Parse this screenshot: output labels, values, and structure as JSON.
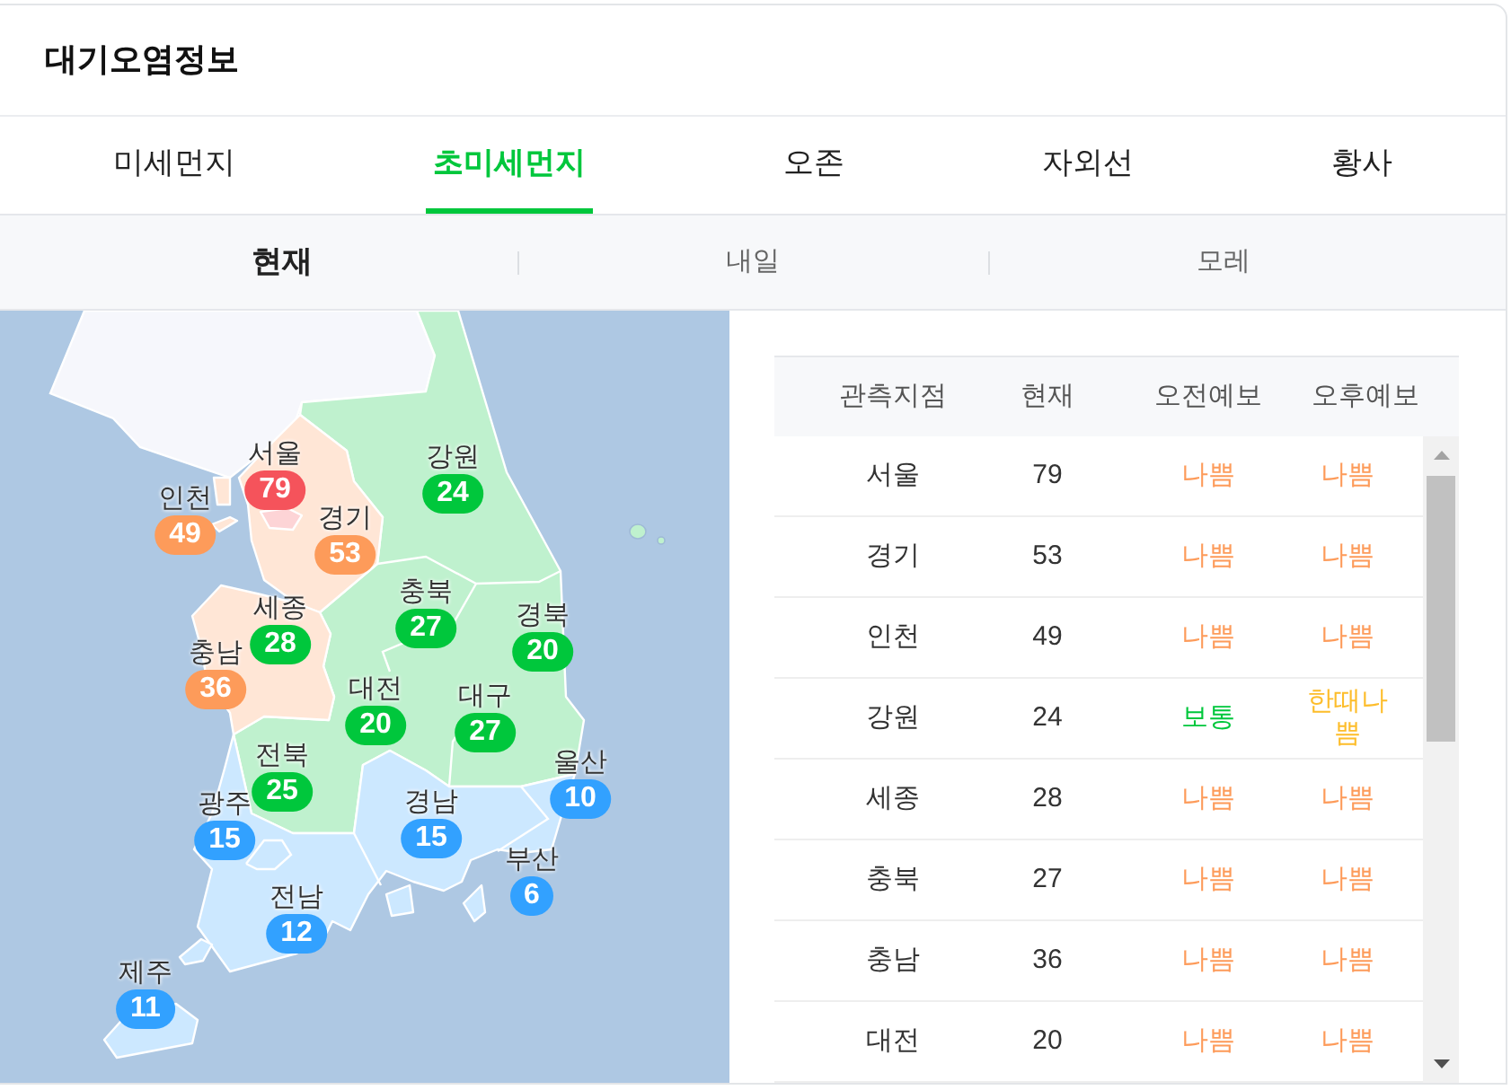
{
  "header": {
    "title": "대기오염정보"
  },
  "tabs": [
    {
      "label": "미세먼지",
      "selected": false
    },
    {
      "label": "초미세먼지",
      "selected": true
    },
    {
      "label": "오존",
      "selected": false
    },
    {
      "label": "자외선",
      "selected": false
    },
    {
      "label": "황사",
      "selected": false
    }
  ],
  "periods": [
    {
      "label": "현재",
      "selected": true
    },
    {
      "label": "내일",
      "selected": false
    },
    {
      "label": "모레",
      "selected": false
    }
  ],
  "map": {
    "markers": [
      {
        "name": "서울",
        "value": "79",
        "color": "#f5535b"
      },
      {
        "name": "강원",
        "value": "24",
        "color": "#00c73c"
      },
      {
        "name": "인천",
        "value": "49",
        "color": "#fd9b5a"
      },
      {
        "name": "경기",
        "value": "53",
        "color": "#fd9b5a"
      },
      {
        "name": "충북",
        "value": "27",
        "color": "#00c73c"
      },
      {
        "name": "세종",
        "value": "28",
        "color": "#00c73c"
      },
      {
        "name": "경북",
        "value": "20",
        "color": "#00c73c"
      },
      {
        "name": "충남",
        "value": "36",
        "color": "#fd9b5a"
      },
      {
        "name": "대전",
        "value": "20",
        "color": "#00c73c"
      },
      {
        "name": "대구",
        "value": "27",
        "color": "#00c73c"
      },
      {
        "name": "전북",
        "value": "25",
        "color": "#00c73c"
      },
      {
        "name": "울산",
        "value": "10",
        "color": "#32a1ff"
      },
      {
        "name": "광주",
        "value": "15",
        "color": "#32a1ff"
      },
      {
        "name": "경남",
        "value": "15",
        "color": "#32a1ff"
      },
      {
        "name": "부산",
        "value": "6",
        "color": "#32a1ff"
      },
      {
        "name": "전남",
        "value": "12",
        "color": "#32a1ff"
      },
      {
        "name": "제주",
        "value": "11",
        "color": "#32a1ff"
      }
    ]
  },
  "table": {
    "columns": [
      "관측지점",
      "현재",
      "오전예보",
      "오후예보"
    ],
    "rows": [
      {
        "station": "서울",
        "current": "79",
        "am": {
          "text": "나쁨",
          "color": "#fd9b5a"
        },
        "pm": {
          "text": "나쁨",
          "color": "#fd9b5a"
        }
      },
      {
        "station": "경기",
        "current": "53",
        "am": {
          "text": "나쁨",
          "color": "#fd9b5a"
        },
        "pm": {
          "text": "나쁨",
          "color": "#fd9b5a"
        }
      },
      {
        "station": "인천",
        "current": "49",
        "am": {
          "text": "나쁨",
          "color": "#fd9b5a"
        },
        "pm": {
          "text": "나쁨",
          "color": "#fd9b5a"
        }
      },
      {
        "station": "강원",
        "current": "24",
        "am": {
          "text": "보통",
          "color": "#00c73c"
        },
        "pm": {
          "text": "한때나쁨",
          "color": "#fdbd2b"
        }
      },
      {
        "station": "세종",
        "current": "28",
        "am": {
          "text": "나쁨",
          "color": "#fd9b5a"
        },
        "pm": {
          "text": "나쁨",
          "color": "#fd9b5a"
        }
      },
      {
        "station": "충북",
        "current": "27",
        "am": {
          "text": "나쁨",
          "color": "#fd9b5a"
        },
        "pm": {
          "text": "나쁨",
          "color": "#fd9b5a"
        }
      },
      {
        "station": "충남",
        "current": "36",
        "am": {
          "text": "나쁨",
          "color": "#fd9b5a"
        },
        "pm": {
          "text": "나쁨",
          "color": "#fd9b5a"
        }
      },
      {
        "station": "대전",
        "current": "20",
        "am": {
          "text": "나쁨",
          "color": "#fd9b5a"
        },
        "pm": {
          "text": "나쁨",
          "color": "#fd9b5a"
        }
      }
    ]
  }
}
